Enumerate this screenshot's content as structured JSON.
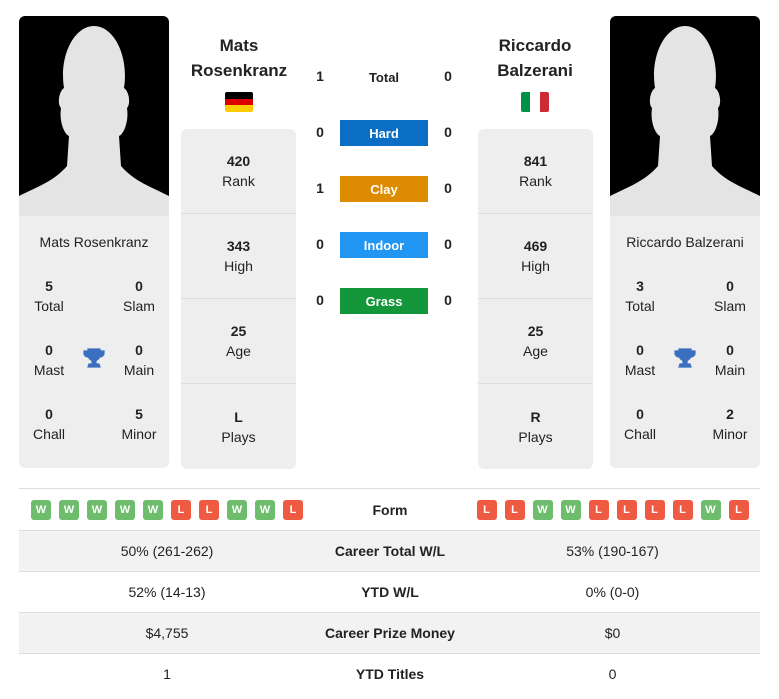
{
  "player1": {
    "name_line1": "Mats",
    "name_line2": "Rosenkranz",
    "full_name": "Mats Rosenkranz",
    "flag": "germany",
    "flag_colors": [
      "#000000",
      "#dd0000",
      "#ffce00"
    ],
    "titles": {
      "total": "5",
      "slam": "0",
      "mast": "0",
      "main": "0",
      "chall": "0",
      "minor": "5"
    },
    "rank": "420",
    "high": "343",
    "age": "25",
    "plays": "L"
  },
  "player2": {
    "name_line1": "Riccardo",
    "name_line2": "Balzerani",
    "full_name": "Riccardo Balzerani",
    "flag": "italy",
    "flag_colors": [
      "#009246",
      "#ffffff",
      "#ce2b37"
    ],
    "titles": {
      "total": "3",
      "slam": "0",
      "mast": "0",
      "main": "0",
      "chall": "0",
      "minor": "2"
    },
    "rank": "841",
    "high": "469",
    "age": "25",
    "plays": "R"
  },
  "labels": {
    "total": "Total",
    "slam": "Slam",
    "mast": "Mast",
    "main": "Main",
    "chall": "Chall",
    "minor": "Minor",
    "rank": "Rank",
    "high": "High",
    "age": "Age",
    "plays": "Plays"
  },
  "h2h": {
    "total": {
      "label": "Total",
      "p1": "1",
      "p2": "0"
    },
    "surfaces": [
      {
        "label": "Hard",
        "p1": "0",
        "p2": "0",
        "color": "#0a6fc4"
      },
      {
        "label": "Clay",
        "p1": "1",
        "p2": "0",
        "color": "#dd8b00"
      },
      {
        "label": "Indoor",
        "p1": "0",
        "p2": "0",
        "color": "#2196f3"
      },
      {
        "label": "Grass",
        "p1": "0",
        "p2": "0",
        "color": "#14973a"
      }
    ]
  },
  "form": {
    "label": "Form",
    "p1": [
      "W",
      "W",
      "W",
      "W",
      "W",
      "L",
      "L",
      "W",
      "W",
      "L"
    ],
    "p2": [
      "L",
      "L",
      "W",
      "W",
      "L",
      "L",
      "L",
      "L",
      "W",
      "L"
    ]
  },
  "comparison": [
    {
      "label": "Career Total W/L",
      "p1": "50% (261-262)",
      "p2": "53% (190-167)"
    },
    {
      "label": "YTD W/L",
      "p1": "52% (14-13)",
      "p2": "0% (0-0)"
    },
    {
      "label": "Career Prize Money",
      "p1": "$4,755",
      "p2": "$0"
    },
    {
      "label": "YTD Titles",
      "p1": "1",
      "p2": "0"
    }
  ]
}
